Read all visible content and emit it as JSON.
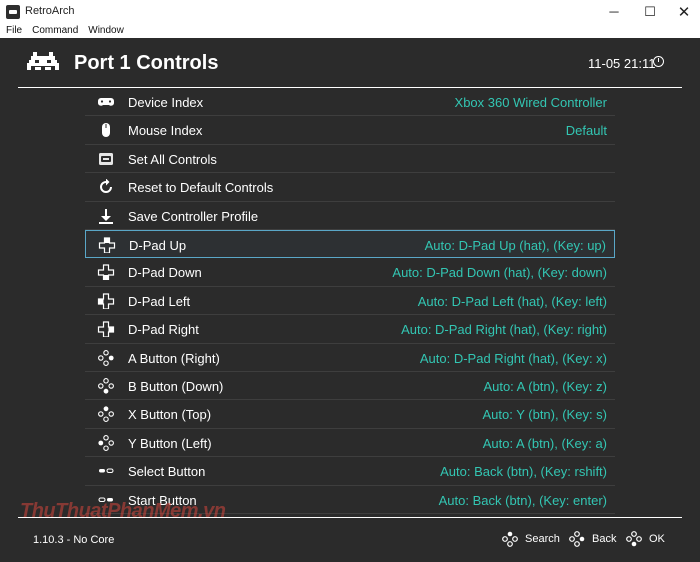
{
  "window": {
    "title": "RetroArch",
    "controls": {
      "minimize": "─",
      "maximize": "☐",
      "close": "✕"
    }
  },
  "menu": [
    "File",
    "Command",
    "Window"
  ],
  "header": {
    "title": "Port 1 Controls",
    "clock": "11-05 21:11"
  },
  "rows": [
    {
      "label": "Device Index",
      "value": "Xbox 360 Wired Controller",
      "icon": "gamepad-icon",
      "selected": false
    },
    {
      "label": "Mouse Index",
      "value": "Default",
      "icon": "mouse-icon",
      "selected": false
    },
    {
      "label": "Set All Controls",
      "value": "",
      "icon": "keyboard-icon",
      "selected": false
    },
    {
      "label": "Reset to Default Controls",
      "value": "",
      "icon": "reset-icon",
      "selected": false
    },
    {
      "label": "Save Controller Profile",
      "value": "",
      "icon": "download-icon",
      "selected": false
    },
    {
      "label": "D-Pad Up",
      "value": "Auto:  D-Pad Up (hat), (Key: up)",
      "icon": "dpad-up-icon",
      "selected": true
    },
    {
      "label": "D-Pad Down",
      "value": "Auto:  D-Pad Down (hat), (Key: down)",
      "icon": "dpad-down-icon",
      "selected": false
    },
    {
      "label": "D-Pad Left",
      "value": "Auto:  D-Pad Left (hat), (Key: left)",
      "icon": "dpad-left-icon",
      "selected": false
    },
    {
      "label": "D-Pad Right",
      "value": "Auto:  D-Pad Right (hat), (Key: right)",
      "icon": "dpad-right-icon",
      "selected": false
    },
    {
      "label": "A Button (Right)",
      "value": "Auto:  D-Pad Right (hat), (Key: x)",
      "icon": "face-button-right-icon",
      "selected": false
    },
    {
      "label": "B Button (Down)",
      "value": "Auto:  A (btn), (Key: z)",
      "icon": "face-button-down-icon",
      "selected": false
    },
    {
      "label": "X Button (Top)",
      "value": "Auto:  Y (btn), (Key: s)",
      "icon": "face-button-top-icon",
      "selected": false
    },
    {
      "label": "Y Button (Left)",
      "value": "Auto:  A (btn), (Key: a)",
      "icon": "face-button-left-icon",
      "selected": false
    },
    {
      "label": "Select Button",
      "value": "Auto:  Back (btn), (Key: rshift)",
      "icon": "select-button-icon",
      "selected": false
    },
    {
      "label": "Start Button",
      "value": "Auto:  Back (btn), (Key: enter)",
      "icon": "start-button-icon",
      "selected": false
    }
  ],
  "footer": {
    "version": "1.10.3 - No Core",
    "search_label": "Search",
    "back_label": "Back",
    "ok_label": "OK"
  },
  "watermark": "ThuThuatPhanMem.vn",
  "colors": {
    "background": "#2b2b2b",
    "value_text": "#33c6b3",
    "selection_border": "#5aa7c8",
    "label_text": "#ffffff"
  }
}
